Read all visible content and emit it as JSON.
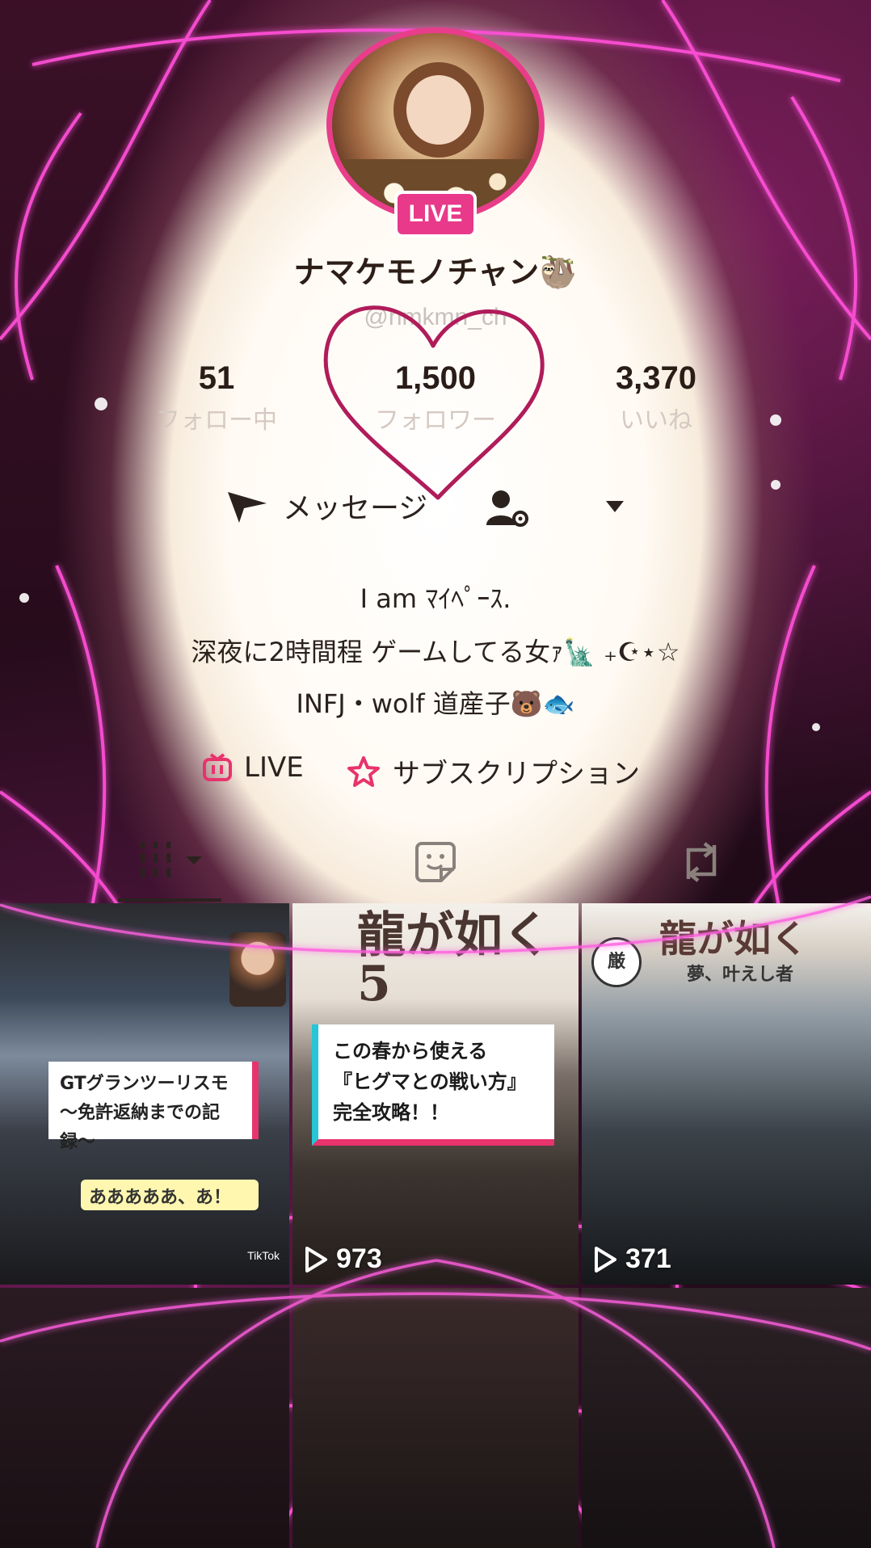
{
  "profile": {
    "live_badge": "LIVE",
    "username": "ナマケモノチャン🦥",
    "handle": "@nmkmn_ch"
  },
  "stats": {
    "following": {
      "value": "51",
      "label": "フォロー中"
    },
    "followers": {
      "value": "1,500",
      "label": "フォロワー"
    },
    "likes": {
      "value": "3,370",
      "label": "いいね"
    }
  },
  "actions": {
    "message_label": "メッセージ",
    "message_icon": "send-icon",
    "person_icon": "person-settings-icon",
    "dropdown_icon": "chevron-down-icon"
  },
  "bio": {
    "line1": "I am ﾏｲﾍﾟｰｽ.",
    "line2": "深夜に2時間程 ゲームしてる女ｧ🗽 ₊☪︎⋆☆",
    "line3": "INFJ・wolf 道産子🐻🐟"
  },
  "links": {
    "live_label": "LIVE",
    "subscription_label": "サブスクリプション"
  },
  "tabs": [
    "videos-grid-icon",
    "favorites-icon",
    "repost-icon"
  ],
  "videos": [
    {
      "views": "",
      "caption": "",
      "overlay1": "GTグランツーリスモ\n〜免許返納までの記録〜",
      "overlay2": "あああああ、あ！",
      "brand": "TikTok"
    },
    {
      "views": "973",
      "caption": "この春から使える\n『ヒグマとの戦い方』\n完全攻略！！",
      "art": "龍が如く5"
    },
    {
      "views": "371",
      "art": "龍が如く",
      "stamp": "厳",
      "subtitle": "夢、叶えし者"
    },
    {
      "views": ""
    },
    {
      "views": ""
    },
    {
      "views": ""
    }
  ],
  "colors": {
    "accent": "#e8398a",
    "heart": "#b01c5a",
    "live_icon": "#e8336d"
  }
}
